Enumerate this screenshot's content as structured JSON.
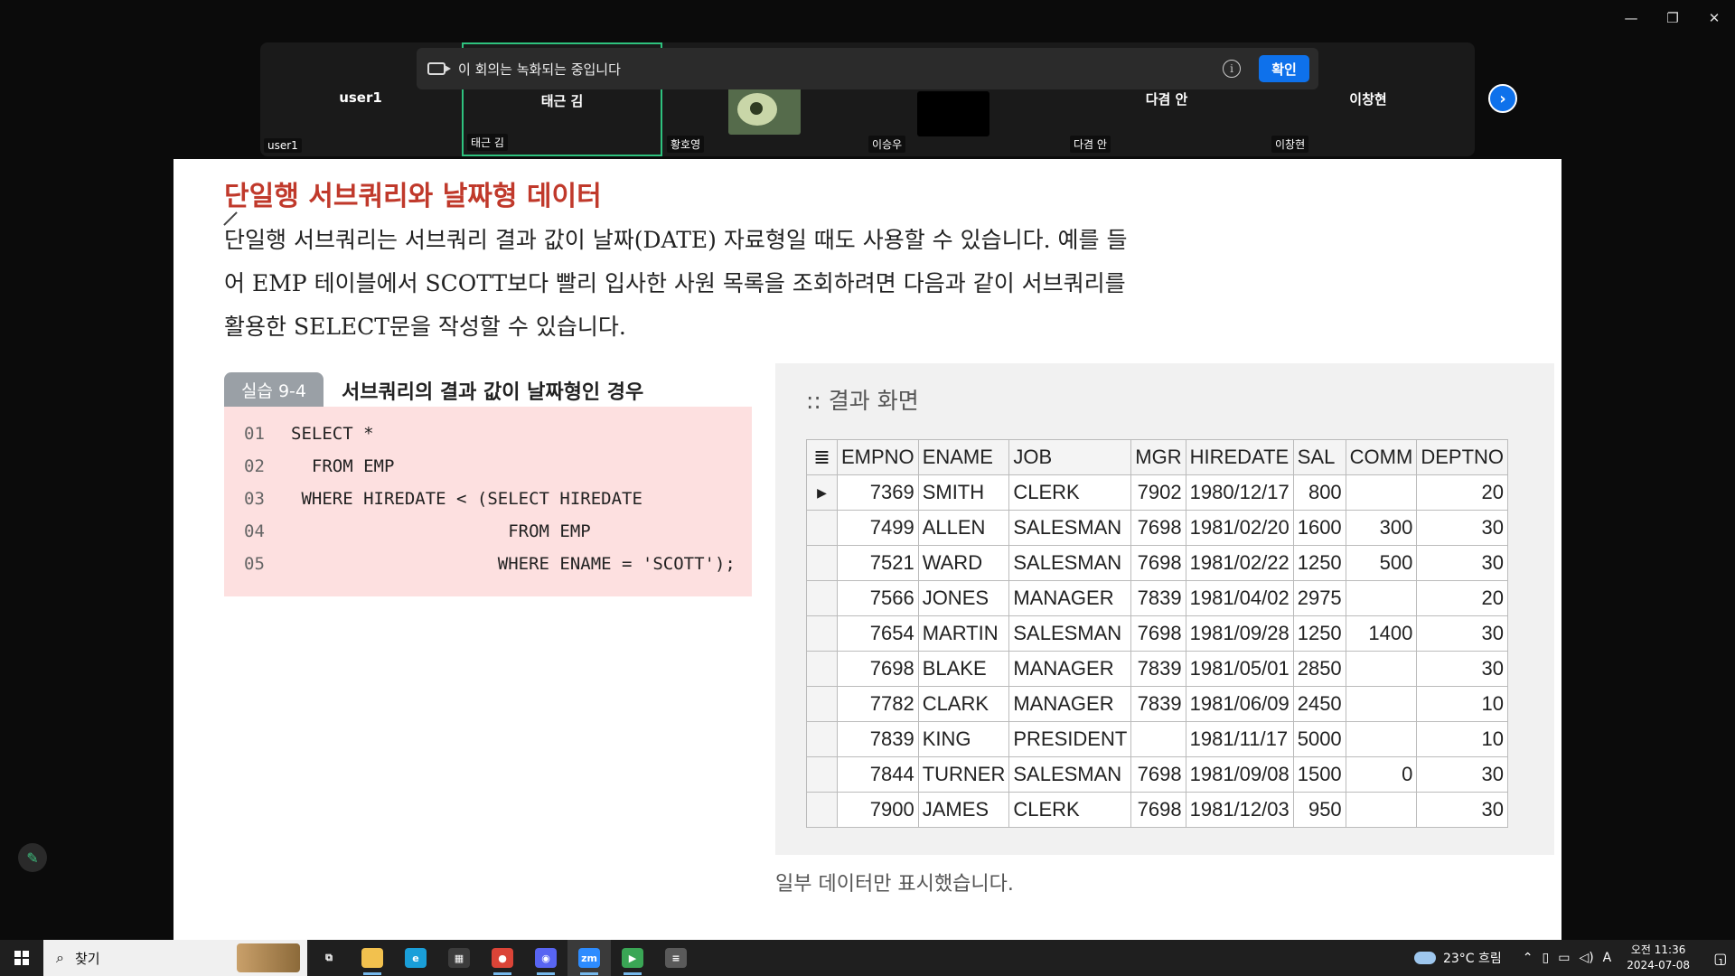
{
  "window": {
    "minimize": "—",
    "restore": "❐",
    "close": "✕"
  },
  "banner": {
    "message": "이 회의는 녹화되는 중입니다",
    "info": "i",
    "confirm": "확인"
  },
  "participants": [
    {
      "center": "user1",
      "corner": "user1"
    },
    {
      "center": "태근 김",
      "corner": "태근 김"
    },
    {
      "center": "",
      "corner": "황호영"
    },
    {
      "center": "",
      "corner": "이승우"
    },
    {
      "center": "다겸 안",
      "corner": "다겸 안"
    },
    {
      "center": "이창현",
      "corner": "이창현"
    }
  ],
  "next": "›",
  "doc": {
    "heading": "단일행 서브쿼리와 날짜형 데이터",
    "paragraph": "단일행 서브쿼리는 서브쿼리 결과 값이 날짜(DATE) 자료형일 때도 사용할 수 있습니다. 예를 들어 EMP 테이블에서 SCOTT보다 빨리 입사한 사원 목록을 조회하려면 다음과 같이 서브쿼리를 활용한 SELECT문을 작성할 수 있습니다.",
    "lab_tag": "실습 9-4",
    "lab_title": "서브쿼리의 결과 값이 날짜형인 경우",
    "code": [
      {
        "ln": "01",
        "text": "SELECT *"
      },
      {
        "ln": "02",
        "text": "  FROM EMP"
      },
      {
        "ln": "03",
        "text": " WHERE HIREDATE < (SELECT HIREDATE"
      },
      {
        "ln": "04",
        "text": "                     FROM EMP"
      },
      {
        "ln": "05",
        "text": "                    WHERE ENAME = 'SCOTT');"
      }
    ],
    "result_title": ":: 결과 화면",
    "columns": [
      "EMPNO",
      "ENAME",
      "JOB",
      "MGR",
      "HIREDATE",
      "SAL",
      "COMM",
      "DEPTNO"
    ],
    "rows": [
      [
        "7369",
        "SMITH",
        "CLERK",
        "7902",
        "1980/12/17",
        "800",
        "",
        "20"
      ],
      [
        "7499",
        "ALLEN",
        "SALESMAN",
        "7698",
        "1981/02/20",
        "1600",
        "300",
        "30"
      ],
      [
        "7521",
        "WARD",
        "SALESMAN",
        "7698",
        "1981/02/22",
        "1250",
        "500",
        "30"
      ],
      [
        "7566",
        "JONES",
        "MANAGER",
        "7839",
        "1981/04/02",
        "2975",
        "",
        "20"
      ],
      [
        "7654",
        "MARTIN",
        "SALESMAN",
        "7698",
        "1981/09/28",
        "1250",
        "1400",
        "30"
      ],
      [
        "7698",
        "BLAKE",
        "MANAGER",
        "7839",
        "1981/05/01",
        "2850",
        "",
        "30"
      ],
      [
        "7782",
        "CLARK",
        "MANAGER",
        "7839",
        "1981/06/09",
        "2450",
        "",
        "10"
      ],
      [
        "7839",
        "KING",
        "PRESIDENT",
        "",
        "1981/11/17",
        "5000",
        "",
        "10"
      ],
      [
        "7844",
        "TURNER",
        "SALESMAN",
        "7698",
        "1981/09/08",
        "1500",
        "0",
        "30"
      ],
      [
        "7900",
        "JAMES",
        "CLERK",
        "7698",
        "1981/12/03",
        "950",
        "",
        "30"
      ]
    ],
    "note": "일부 데이터만 표시했습니다."
  },
  "taskbar": {
    "search_label": "찾기",
    "apps": [
      {
        "name": "task-view-icon",
        "glyph": "⧉",
        "bg": "",
        "open": false
      },
      {
        "name": "file-explorer-icon",
        "glyph": "",
        "bg": "#f2c14e",
        "open": true
      },
      {
        "name": "edge-icon",
        "glyph": "e",
        "bg": "#1a9fd9",
        "open": false
      },
      {
        "name": "store-icon",
        "glyph": "▦",
        "bg": "#3c3c3c",
        "open": false
      },
      {
        "name": "chrome-icon",
        "glyph": "●",
        "bg": "#db4437",
        "open": true
      },
      {
        "name": "discord-icon",
        "glyph": "◉",
        "bg": "#5865f2",
        "open": true
      },
      {
        "name": "zoom-icon",
        "glyph": "zm",
        "bg": "#2d8cff",
        "open": true
      },
      {
        "name": "media-app-icon",
        "glyph": "▶",
        "bg": "#3aa655",
        "open": true
      },
      {
        "name": "document-app-icon",
        "glyph": "≡",
        "bg": "#5a5a5a",
        "open": false
      }
    ],
    "weather": "23°C 흐림",
    "ime": "A",
    "clock_time": "오전 11:36",
    "clock_date": "2024-07-08",
    "notif_count": "1"
  }
}
